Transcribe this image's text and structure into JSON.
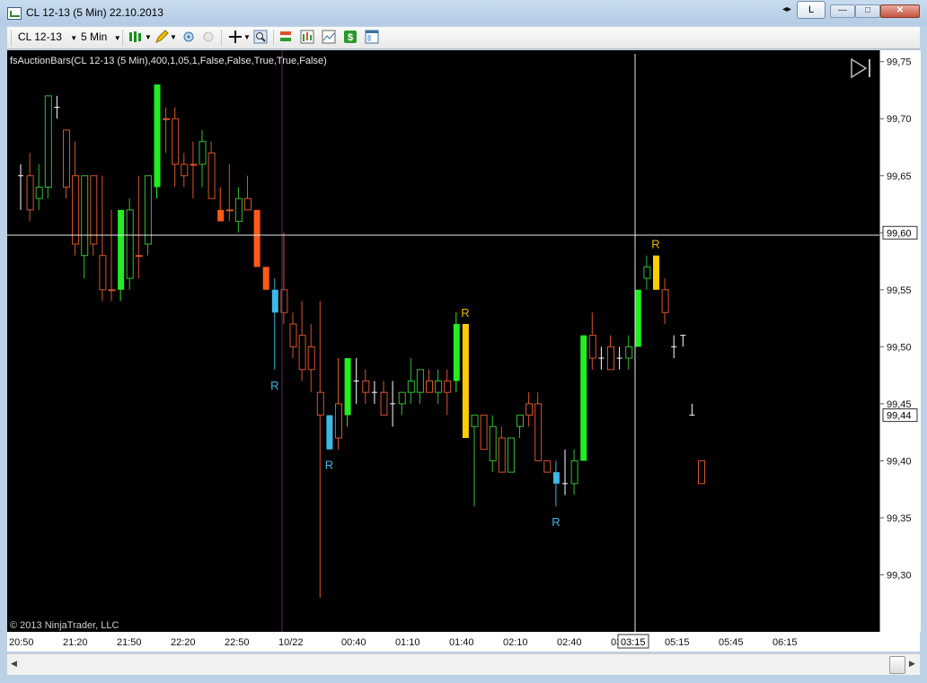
{
  "window": {
    "title": "CL 12-13 (5 Min)  22.10.2013",
    "link_button": "L",
    "nav_arrows": "◂▸",
    "minimize": "—",
    "maximize": "□",
    "close": "✕"
  },
  "toolbar": {
    "instrument": "CL 12-13",
    "interval": "5 Min"
  },
  "chart": {
    "indicator_label": "fsAuctionBars(CL 12-13 (5 Min),400,1,05,1,False,False,True,True,False)",
    "copyright": "© 2013 NinjaTrader, LLC",
    "crosshair_price": "99,60",
    "crosshair_time": "03:15",
    "last_price": "99,44",
    "colors": {
      "up": "#33bb33",
      "down": "#d9532a",
      "bull": "#22ee22",
      "bear": "#ff5a1a",
      "cyan": "#3db8e6",
      "gold": "#ffcc00",
      "label_cyan": "#3db8e6",
      "label_gold": "#e6b800"
    }
  },
  "chart_data": {
    "type": "candlestick",
    "ylim": [
      99.25,
      99.76
    ],
    "y_ticks": [
      "99,75",
      "99,70",
      "99,65",
      "99,60",
      "99,55",
      "99,50",
      "99,45",
      "99,40",
      "99,35",
      "99,30"
    ],
    "x_ticks": [
      "20:50",
      "21:20",
      "21:50",
      "22:20",
      "22:50",
      "10/22",
      "00:40",
      "01:10",
      "01:40",
      "02:10",
      "02:40",
      "03:10",
      "05:15",
      "05:45",
      "06:15"
    ],
    "bars": [
      {
        "o": 99.65,
        "h": 99.66,
        "l": 99.62,
        "c": 99.65,
        "s": "doji"
      },
      {
        "o": 99.65,
        "h": 99.67,
        "l": 99.61,
        "c": 99.62,
        "s": "down"
      },
      {
        "o": 99.63,
        "h": 99.66,
        "l": 99.62,
        "c": 99.64,
        "s": "up"
      },
      {
        "o": 99.64,
        "h": 99.72,
        "l": 99.63,
        "c": 99.72,
        "s": "up"
      },
      {
        "o": 99.71,
        "h": 99.72,
        "l": 99.7,
        "c": 99.71,
        "s": "doji"
      },
      {
        "o": 99.69,
        "h": 99.69,
        "l": 99.63,
        "c": 99.64,
        "s": "down"
      },
      {
        "o": 99.65,
        "h": 99.68,
        "l": 99.58,
        "c": 99.59,
        "s": "down"
      },
      {
        "o": 99.58,
        "h": 99.65,
        "l": 99.56,
        "c": 99.65,
        "s": "up"
      },
      {
        "o": 99.65,
        "h": 99.65,
        "l": 99.58,
        "c": 99.59,
        "s": "down"
      },
      {
        "o": 99.58,
        "h": 99.65,
        "l": 99.54,
        "c": 99.55,
        "s": "down"
      },
      {
        "o": 99.55,
        "h": 99.62,
        "l": 99.54,
        "c": 99.55,
        "s": "down"
      },
      {
        "o": 99.55,
        "h": 99.62,
        "l": 99.54,
        "c": 99.62,
        "s": "bull"
      },
      {
        "o": 99.56,
        "h": 99.63,
        "l": 99.55,
        "c": 99.62,
        "s": "up"
      },
      {
        "o": 99.58,
        "h": 99.65,
        "l": 99.56,
        "c": 99.58,
        "s": "down"
      },
      {
        "o": 99.59,
        "h": 99.65,
        "l": 99.58,
        "c": 99.65,
        "s": "up"
      },
      {
        "o": 99.64,
        "h": 99.73,
        "l": 99.63,
        "c": 99.73,
        "s": "bull"
      },
      {
        "o": 99.7,
        "h": 99.71,
        "l": 99.67,
        "c": 99.7,
        "s": "down"
      },
      {
        "o": 99.7,
        "h": 99.71,
        "l": 99.64,
        "c": 99.66,
        "s": "down"
      },
      {
        "o": 99.66,
        "h": 99.67,
        "l": 99.64,
        "c": 99.65,
        "s": "down"
      },
      {
        "o": 99.66,
        "h": 99.68,
        "l": 99.63,
        "c": 99.66,
        "s": "down"
      },
      {
        "o": 99.66,
        "h": 99.69,
        "l": 99.64,
        "c": 99.68,
        "s": "up"
      },
      {
        "o": 99.67,
        "h": 99.68,
        "l": 99.63,
        "c": 99.63,
        "s": "down"
      },
      {
        "o": 99.62,
        "h": 99.64,
        "l": 99.61,
        "c": 99.61,
        "s": "bear"
      },
      {
        "o": 99.62,
        "h": 99.66,
        "l": 99.61,
        "c": 99.62,
        "s": "down"
      },
      {
        "o": 99.61,
        "h": 99.64,
        "l": 99.6,
        "c": 99.63,
        "s": "up"
      },
      {
        "o": 99.63,
        "h": 99.65,
        "l": 99.62,
        "c": 99.62,
        "s": "down"
      },
      {
        "o": 99.62,
        "h": 99.62,
        "l": 99.57,
        "c": 99.57,
        "s": "bear"
      },
      {
        "o": 99.57,
        "h": 99.57,
        "l": 99.55,
        "c": 99.55,
        "s": "bear"
      },
      {
        "o": 99.55,
        "h": 99.56,
        "l": 99.48,
        "c": 99.53,
        "s": "cyan"
      },
      {
        "o": 99.55,
        "h": 99.6,
        "l": 99.52,
        "c": 99.53,
        "s": "down"
      },
      {
        "o": 99.52,
        "h": 99.53,
        "l": 99.49,
        "c": 99.5,
        "s": "down"
      },
      {
        "o": 99.51,
        "h": 99.54,
        "l": 99.47,
        "c": 99.48,
        "s": "down"
      },
      {
        "o": 99.5,
        "h": 99.52,
        "l": 99.46,
        "c": 99.48,
        "s": "down"
      },
      {
        "o": 99.46,
        "h": 99.54,
        "l": 99.28,
        "c": 99.44,
        "s": "down"
      },
      {
        "o": 99.44,
        "h": 99.44,
        "l": 99.41,
        "c": 99.41,
        "s": "cyan"
      },
      {
        "o": 99.45,
        "h": 99.49,
        "l": 99.41,
        "c": 99.42,
        "s": "down"
      },
      {
        "o": 99.44,
        "h": 99.49,
        "l": 99.43,
        "c": 99.49,
        "s": "bull"
      },
      {
        "o": 99.47,
        "h": 99.49,
        "l": 99.45,
        "c": 99.47,
        "s": "doji"
      },
      {
        "o": 99.46,
        "h": 99.48,
        "l": 99.45,
        "c": 99.47,
        "s": "down"
      },
      {
        "o": 99.46,
        "h": 99.47,
        "l": 99.45,
        "c": 99.46,
        "s": "doji"
      },
      {
        "o": 99.46,
        "h": 99.47,
        "l": 99.44,
        "c": 99.44,
        "s": "down"
      },
      {
        "o": 99.45,
        "h": 99.47,
        "l": 99.43,
        "c": 99.45,
        "s": "doji"
      },
      {
        "o": 99.45,
        "h": 99.46,
        "l": 99.44,
        "c": 99.46,
        "s": "up"
      },
      {
        "o": 99.46,
        "h": 99.49,
        "l": 99.45,
        "c": 99.47,
        "s": "up"
      },
      {
        "o": 99.46,
        "h": 99.48,
        "l": 99.45,
        "c": 99.48,
        "s": "up"
      },
      {
        "o": 99.47,
        "h": 99.48,
        "l": 99.46,
        "c": 99.46,
        "s": "down"
      },
      {
        "o": 99.46,
        "h": 99.48,
        "l": 99.45,
        "c": 99.47,
        "s": "up"
      },
      {
        "o": 99.47,
        "h": 99.48,
        "l": 99.44,
        "c": 99.46,
        "s": "down"
      },
      {
        "o": 99.47,
        "h": 99.53,
        "l": 99.46,
        "c": 99.52,
        "s": "bull"
      },
      {
        "o": 99.52,
        "h": 99.52,
        "l": 99.42,
        "c": 99.42,
        "s": "gold"
      },
      {
        "o": 99.43,
        "h": 99.44,
        "l": 99.36,
        "c": 99.44,
        "s": "up"
      },
      {
        "o": 99.44,
        "h": 99.44,
        "l": 99.41,
        "c": 99.41,
        "s": "down"
      },
      {
        "o": 99.4,
        "h": 99.44,
        "l": 99.39,
        "c": 99.43,
        "s": "up"
      },
      {
        "o": 99.42,
        "h": 99.43,
        "l": 99.39,
        "c": 99.39,
        "s": "down"
      },
      {
        "o": 99.39,
        "h": 99.42,
        "l": 99.39,
        "c": 99.42,
        "s": "up"
      },
      {
        "o": 99.43,
        "h": 99.44,
        "l": 99.42,
        "c": 99.44,
        "s": "up"
      },
      {
        "o": 99.45,
        "h": 99.46,
        "l": 99.43,
        "c": 99.44,
        "s": "down"
      },
      {
        "o": 99.45,
        "h": 99.46,
        "l": 99.4,
        "c": 99.4,
        "s": "down"
      },
      {
        "o": 99.4,
        "h": 99.4,
        "l": 99.39,
        "c": 99.39,
        "s": "down"
      },
      {
        "o": 99.38,
        "h": 99.4,
        "l": 99.36,
        "c": 99.39,
        "s": "cyan"
      },
      {
        "o": 99.38,
        "h": 99.41,
        "l": 99.37,
        "c": 99.38,
        "s": "doji"
      },
      {
        "o": 99.38,
        "h": 99.41,
        "l": 99.37,
        "c": 99.4,
        "s": "up"
      },
      {
        "o": 99.4,
        "h": 99.51,
        "l": 99.4,
        "c": 99.51,
        "s": "bull"
      },
      {
        "o": 99.51,
        "h": 99.53,
        "l": 99.48,
        "c": 99.49,
        "s": "down"
      },
      {
        "o": 99.49,
        "h": 99.5,
        "l": 99.48,
        "c": 99.49,
        "s": "doji"
      },
      {
        "o": 99.5,
        "h": 99.51,
        "l": 99.48,
        "c": 99.48,
        "s": "down"
      },
      {
        "o": 99.49,
        "h": 99.5,
        "l": 99.48,
        "c": 99.49,
        "s": "doji"
      },
      {
        "o": 99.49,
        "h": 99.51,
        "l": 99.48,
        "c": 99.5,
        "s": "up"
      },
      {
        "o": 99.5,
        "h": 99.55,
        "l": 99.5,
        "c": 99.55,
        "s": "bull"
      },
      {
        "o": 99.56,
        "h": 99.58,
        "l": 99.55,
        "c": 99.57,
        "s": "up"
      },
      {
        "o": 99.58,
        "h": 99.58,
        "l": 99.55,
        "c": 99.55,
        "s": "gold"
      },
      {
        "o": 99.55,
        "h": 99.56,
        "l": 99.52,
        "c": 99.53,
        "s": "down"
      },
      {
        "o": 99.5,
        "h": 99.51,
        "l": 99.49,
        "c": 99.5,
        "s": "doji"
      },
      {
        "o": 99.51,
        "h": 99.51,
        "l": 99.5,
        "c": 99.51,
        "s": "doji"
      },
      {
        "o": 99.44,
        "h": 99.45,
        "l": 99.44,
        "c": 99.44,
        "s": "doji"
      },
      {
        "o": 99.4,
        "h": 99.4,
        "l": 99.38,
        "c": 99.38,
        "s": "down"
      }
    ],
    "markers": [
      {
        "bar": 28,
        "label": "R",
        "color": "cyan",
        "pos": "below"
      },
      {
        "bar": 34,
        "label": "R",
        "color": "cyan",
        "pos": "below"
      },
      {
        "bar": 49,
        "label": "R",
        "color": "gold",
        "pos": "above"
      },
      {
        "bar": 59,
        "label": "R",
        "color": "cyan",
        "pos": "below"
      },
      {
        "bar": 70,
        "label": "R",
        "color": "gold",
        "pos": "above"
      }
    ]
  }
}
